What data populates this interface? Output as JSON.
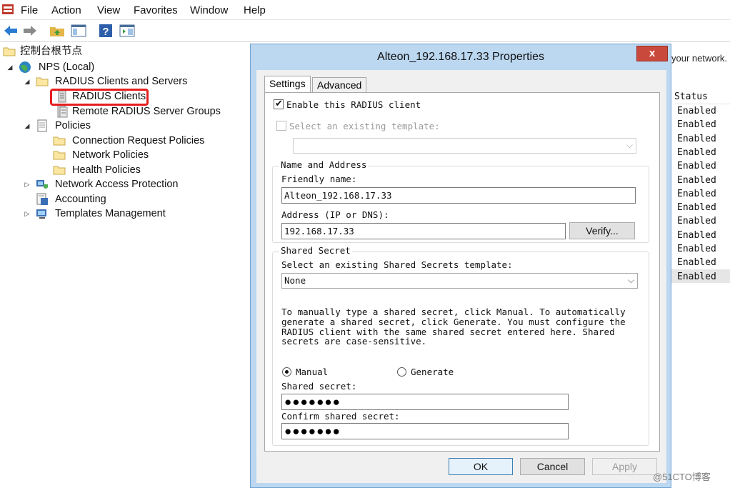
{
  "menu": {
    "items": [
      "File",
      "Action",
      "View",
      "Favorites",
      "Window",
      "Help"
    ]
  },
  "tree": {
    "root": "控制台根节点",
    "nps": "NPS (Local)",
    "radius_clients_servers": "RADIUS Clients and Servers",
    "radius_clients": "RADIUS Clients",
    "remote_groups": "Remote RADIUS Server Groups",
    "policies": "Policies",
    "conn_req": "Connection Request Policies",
    "network_policies": "Network Policies",
    "health_policies": "Health Policies",
    "nap": "Network Access Protection",
    "accounting": "Accounting",
    "templates": "Templates Management"
  },
  "background_list": {
    "note": "your network.",
    "status_header": "Status",
    "status_values": [
      "Enabled",
      "Enabled",
      "Enabled",
      "Enabled",
      "Enabled",
      "Enabled",
      "Enabled",
      "Enabled",
      "Enabled",
      "Enabled",
      "Enabled",
      "Enabled",
      "Enabled"
    ]
  },
  "dialog": {
    "title": "Alteon_192.168.17.33 Properties",
    "close_glyph": "x",
    "tabs": {
      "settings": "Settings",
      "advanced": "Advanced"
    },
    "enable_label": "Enable this RADIUS client",
    "enable_checked": true,
    "template_label": "Select an existing template:",
    "template_checked": false,
    "template_value": "",
    "name_address": {
      "title": "Name and Address",
      "friendly_label": "Friendly name:",
      "friendly_value": "Alteon_192.168.17.33",
      "address_label": "Address (IP or DNS):",
      "address_value": "192.168.17.33",
      "verify_label": "Verify..."
    },
    "shared_secret": {
      "title": "Shared Secret",
      "select_label": "Select an existing Shared Secrets template:",
      "select_value": "None",
      "help_lines": [
        "To manually type a shared secret, click Manual. To automatically",
        "generate a shared secret, click Generate. You must configure the",
        "RADIUS client with the same shared secret entered here. Shared",
        "secrets are case-sensitive."
      ],
      "manual_label": "Manual",
      "generate_label": "Generate",
      "mode": "Manual",
      "secret_label": "Shared secret:",
      "secret_dots": "●●●●●●●",
      "confirm_label": "Confirm shared secret:",
      "confirm_dots": "●●●●●●●"
    },
    "buttons": {
      "ok": "OK",
      "cancel": "Cancel",
      "apply": "Apply"
    }
  },
  "watermark": "@51CTO博客"
}
